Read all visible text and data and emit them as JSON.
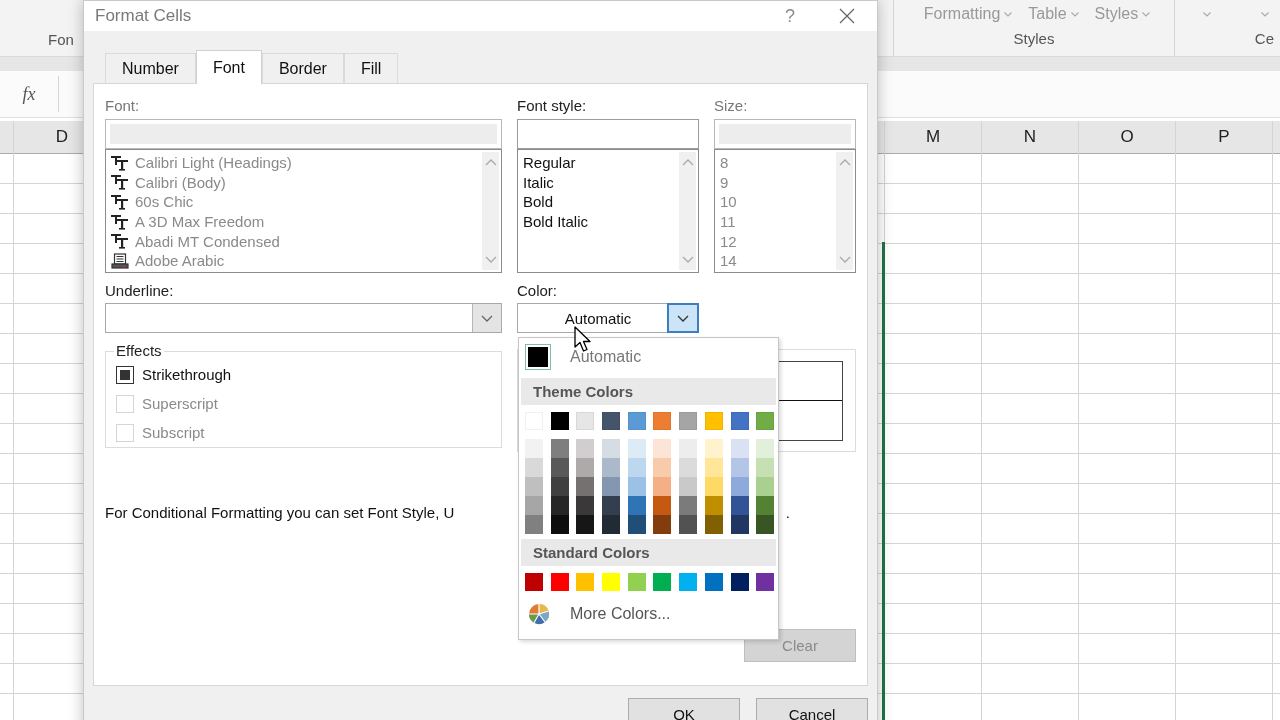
{
  "spreadsheet": {
    "ribbon": {
      "left_group_label": "Fon",
      "buttons": [
        {
          "label": "Formatting"
        },
        {
          "label": "Table"
        },
        {
          "label": "Styles"
        }
      ],
      "group_label": "Styles",
      "right_group_label": "Ce"
    },
    "function_label": "fx",
    "columns_left": [
      "D"
    ],
    "columns_right": [
      "M",
      "N",
      "O",
      "P"
    ]
  },
  "dialog": {
    "title": "Format Cells",
    "help": "?",
    "tabs": [
      {
        "label": "Number",
        "selected": false
      },
      {
        "label": "Font",
        "selected": true
      },
      {
        "label": "Border",
        "selected": false
      },
      {
        "label": "Fill",
        "selected": false
      }
    ],
    "font": {
      "label": "Font:",
      "disabled": true,
      "items": [
        {
          "name": "Calibri Light (Headings)",
          "kind": "truetype"
        },
        {
          "name": "Calibri (Body)",
          "kind": "truetype"
        },
        {
          "name": "60s Chic",
          "kind": "truetype"
        },
        {
          "name": "A 3D Max Freedom",
          "kind": "truetype"
        },
        {
          "name": "Abadi MT Condensed",
          "kind": "truetype"
        },
        {
          "name": "Adobe Arabic",
          "kind": "printer"
        }
      ]
    },
    "font_style": {
      "label": "Font style:",
      "disabled": false,
      "items": [
        "Regular",
        "Italic",
        "Bold",
        "Bold Italic"
      ]
    },
    "size": {
      "label": "Size:",
      "disabled": true,
      "items": [
        "8",
        "9",
        "10",
        "11",
        "12",
        "14"
      ]
    },
    "underline": {
      "label": "Underline:"
    },
    "color": {
      "label": "Color:",
      "value": "Automatic",
      "expanded": true
    },
    "effects": {
      "title": "Effects",
      "options": [
        {
          "label": "Strikethrough",
          "checked": true,
          "disabled": false
        },
        {
          "label": "Superscript",
          "checked": false,
          "disabled": true
        },
        {
          "label": "Subscript",
          "checked": false,
          "disabled": true
        }
      ]
    },
    "note": "For Conditional Formatting you can set Font Style, U",
    "note_tail": ".",
    "clear": {
      "label": "Clear",
      "disabled": true
    },
    "ok": "OK",
    "cancel": "Cancel"
  },
  "color_menu": {
    "automatic": {
      "label": "Automatic",
      "color": "#000000"
    },
    "theme_title": "Theme Colors",
    "theme_colors": [
      {
        "color": "#ffffff",
        "shades": [
          {
            "color": "#f2f2f2"
          },
          {
            "color": "#d9d9d9"
          },
          {
            "color": "#bfbfbf"
          },
          {
            "color": "#a6a6a6"
          },
          {
            "color": "#808080"
          }
        ]
      },
      {
        "color": "#000000",
        "shades": [
          {
            "color": "#7f7f7f"
          },
          {
            "color": "#595959"
          },
          {
            "color": "#404040"
          },
          {
            "color": "#262626"
          },
          {
            "color": "#0d0d0d"
          }
        ]
      },
      {
        "color": "#e7e6e6",
        "shades": [
          {
            "color": "#d0cece"
          },
          {
            "color": "#aeaaaa"
          },
          {
            "color": "#757171"
          },
          {
            "color": "#3a3838"
          },
          {
            "color": "#171616"
          }
        ]
      },
      {
        "color": "#44546a",
        "shades": [
          {
            "color": "#d6dce4"
          },
          {
            "color": "#acb9ca"
          },
          {
            "color": "#8497b0"
          },
          {
            "color": "#333f4f"
          },
          {
            "color": "#222a35"
          }
        ]
      },
      {
        "color": "#5b9bd5",
        "shades": [
          {
            "color": "#ddebf7"
          },
          {
            "color": "#bdd7ee"
          },
          {
            "color": "#9bc2e6"
          },
          {
            "color": "#2f75b5"
          },
          {
            "color": "#1f4e78"
          }
        ]
      },
      {
        "color": "#ed7d31",
        "shades": [
          {
            "color": "#fce4d6"
          },
          {
            "color": "#f8cbad"
          },
          {
            "color": "#f4b084"
          },
          {
            "color": "#c65911"
          },
          {
            "color": "#833c0c"
          }
        ]
      },
      {
        "color": "#a5a5a5",
        "shades": [
          {
            "color": "#ededed"
          },
          {
            "color": "#dbdbdb"
          },
          {
            "color": "#c9c9c9"
          },
          {
            "color": "#7b7b7b"
          },
          {
            "color": "#525252"
          }
        ]
      },
      {
        "color": "#ffc000",
        "shades": [
          {
            "color": "#fff2cc"
          },
          {
            "color": "#ffe699"
          },
          {
            "color": "#ffd966"
          },
          {
            "color": "#bf8f00"
          },
          {
            "color": "#806000"
          }
        ]
      },
      {
        "color": "#4472c4",
        "shades": [
          {
            "color": "#d9e1f2"
          },
          {
            "color": "#b4c6e7"
          },
          {
            "color": "#8ea9db"
          },
          {
            "color": "#305496"
          },
          {
            "color": "#203764"
          }
        ]
      },
      {
        "color": "#70ad47",
        "shades": [
          {
            "color": "#e2efda"
          },
          {
            "color": "#c6e0b4"
          },
          {
            "color": "#a9d08e"
          },
          {
            "color": "#548235"
          },
          {
            "color": "#375623"
          }
        ]
      }
    ],
    "standard_title": "Standard Colors",
    "standard_colors": [
      {
        "color": "#c00000"
      },
      {
        "color": "#ff0000"
      },
      {
        "color": "#ffc000"
      },
      {
        "color": "#ffff00"
      },
      {
        "color": "#92d050"
      },
      {
        "color": "#00b050"
      },
      {
        "color": "#00b0f0"
      },
      {
        "color": "#0070c0"
      },
      {
        "color": "#002060"
      },
      {
        "color": "#7030a0"
      }
    ],
    "more": "More Colors..."
  }
}
